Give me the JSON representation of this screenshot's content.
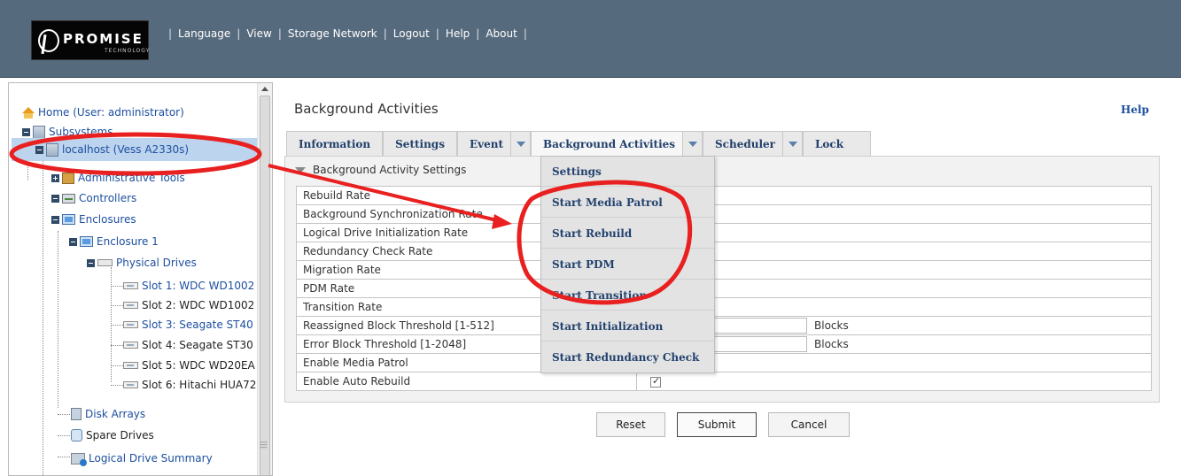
{
  "header": {
    "logo_text": "PROMISE",
    "logo_sub": "TECHNOLOGY",
    "nav": [
      "Language",
      "View",
      "Storage Network",
      "Logout",
      "Help",
      "About"
    ]
  },
  "tree": {
    "home": "Home (User: administrator)",
    "subsystems": "Subsystems",
    "localhost": "localhost (Vess A2330s)",
    "admin_tools": "Administrative Tools",
    "controllers": "Controllers",
    "enclosures": "Enclosures",
    "enclosure1": "Enclosure 1",
    "physical_drives": "Physical Drives",
    "slots": [
      "Slot 1: WDC WD1002",
      "Slot 2: WDC WD1002",
      "Slot 3: Seagate ST40",
      "Slot 4: Seagate ST30",
      "Slot 5: WDC WD20EA",
      "Slot 6: Hitachi HUA72"
    ],
    "disk_arrays": "Disk Arrays",
    "spare_drives": "Spare Drives",
    "ld_summary": "Logical Drive Summary"
  },
  "content": {
    "title": "Background Activities",
    "help": "Help",
    "tabs": [
      "Information",
      "Settings",
      "Event",
      "Background Activities",
      "Scheduler",
      "Lock"
    ],
    "section": "Background Activity Settings",
    "rows": [
      "Rebuild Rate",
      "Background Synchronization Rate",
      "Logical Drive Initialization Rate",
      "Redundancy Check Rate",
      "Migration Rate",
      "PDM Rate",
      "Transition Rate",
      "Reassigned Block Threshold [1-512]",
      "Error Block Threshold [1-2048]",
      "Enable Media Patrol",
      "Enable Auto Rebuild"
    ],
    "unit_blocks": "Blocks",
    "buttons": {
      "reset": "Reset",
      "submit": "Submit",
      "cancel": "Cancel"
    }
  },
  "dropdown": [
    "Settings",
    "Start Media Patrol",
    "Start Rebuild",
    "Start PDM",
    "Start Transition",
    "Start Initialization",
    "Start Redundancy Check"
  ],
  "colors": {
    "header_bg": "#566a7d",
    "link": "#1d4fa0",
    "annotation": "#e8201f",
    "selected_row": "#bcd4ee"
  }
}
